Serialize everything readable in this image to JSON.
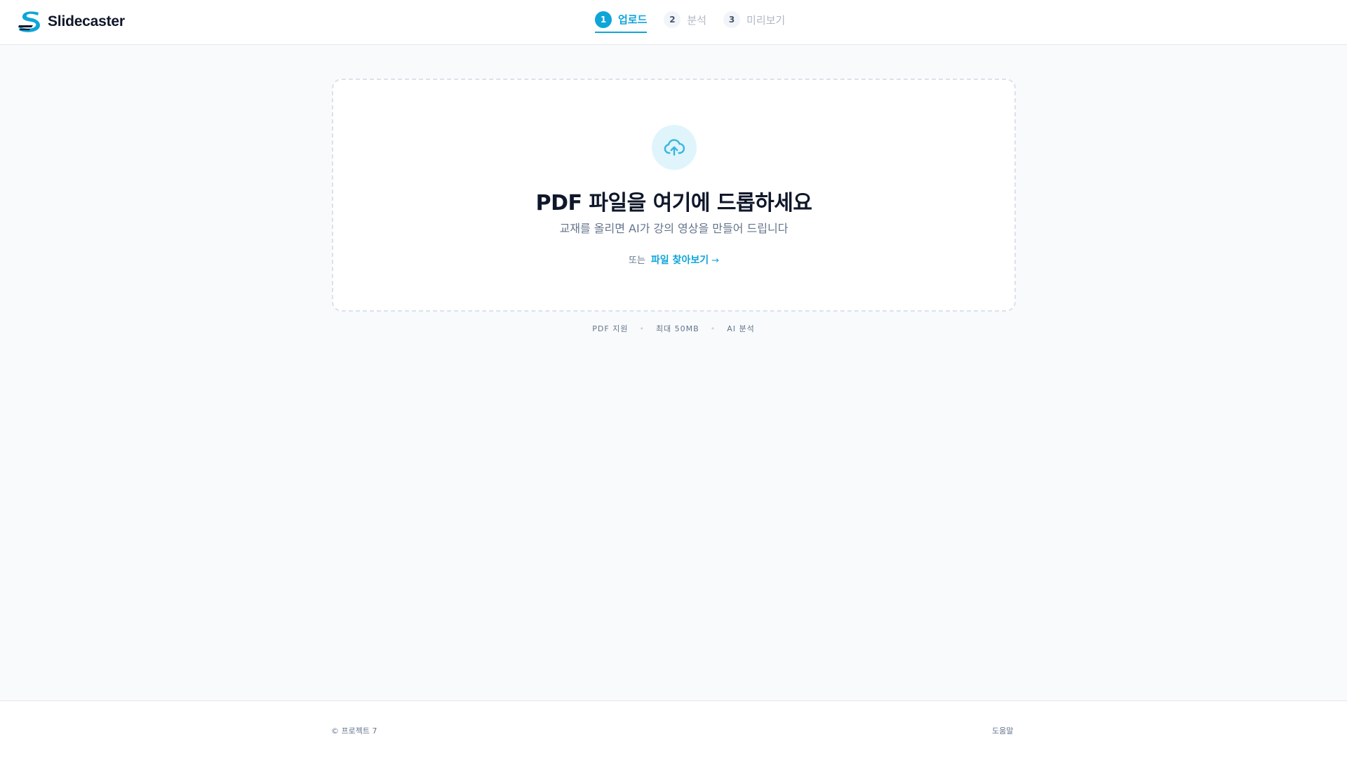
{
  "header": {
    "logo_text": "Slidecaster",
    "steps": [
      {
        "num": "1",
        "label": "업로드",
        "active": true
      },
      {
        "num": "2",
        "label": "분석",
        "active": false
      },
      {
        "num": "3",
        "label": "미리보기",
        "active": false
      }
    ]
  },
  "dropzone": {
    "icon": "cloud-upload-icon",
    "title": "PDF 파일을 여기에 드롭하세요",
    "subtitle": "교재를 올리면 AI가 강의 영상을 만들어 드립니다",
    "or_text": "또는",
    "browse_label": "파일 찾아보기",
    "browse_arrow": "→"
  },
  "meta": {
    "items": [
      "PDF 지원",
      "최대 50MB",
      "AI 분석"
    ]
  },
  "footer": {
    "copyright": "© 프로젝트 7",
    "help": "도움말"
  },
  "colors": {
    "accent": "#0ea5d9",
    "text": "#0f172a",
    "muted": "#64748b",
    "background": "#f8fafc"
  }
}
